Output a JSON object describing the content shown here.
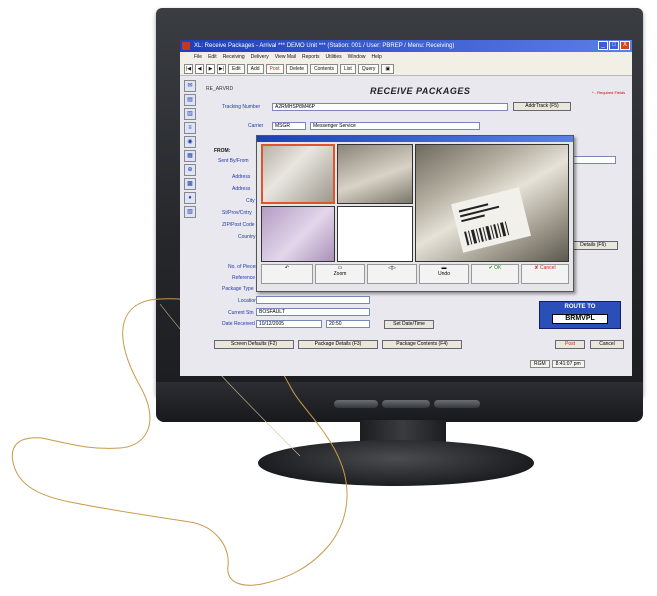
{
  "window": {
    "title": "XL: Receive Packages - Arrival *** DEMO Unit *** (Station: 001 / User: PBREP / Menu: Receiving)",
    "controls": [
      "_",
      "□",
      "X"
    ]
  },
  "menu": [
    "File",
    "Edit",
    "Receiving",
    "Delivery",
    "View Mail",
    "Reports",
    "Utilities",
    "Window",
    "Help"
  ],
  "toolbar": {
    "nav": [
      "|◀",
      "◀",
      "▶",
      "▶|"
    ],
    "buttons": [
      "Edit",
      "Add",
      "Post",
      "Delete",
      "Contents",
      "List",
      "Query"
    ]
  },
  "form": {
    "code": "RE_ARVRD",
    "heading": "RECEIVE PACKAGES",
    "required_note": "* - Required Fields",
    "tracking_label": "Tracking Number",
    "tracking_value": "A2RMHSP8M46P",
    "add_track_button": "AddrTrack (F5)",
    "carrier_label": "Carrier",
    "carrier_code": "MSGR",
    "carrier_name": "Messenger Service",
    "from_label": "FROM:",
    "from_labels": [
      "Sent By/From",
      "Address",
      "Address",
      "City",
      "St/Prov/Cntry",
      "ZIP/Post Code",
      "Country"
    ],
    "recipient_details_button": "Details (F6)",
    "misc_labels": [
      "No. of Pieces",
      "Reference",
      "Package Type",
      "Location",
      "Current Stn",
      "Date Received"
    ],
    "current_stn_value": "BOSFAULT",
    "date_value": "10/12/2005",
    "time_value": "20:50",
    "set_date_button": "Set Date/Time",
    "bottom_buttons": [
      "Screen Defaults (F2)",
      "Package Details (F3)",
      "Package Contents (F4)"
    ],
    "post_button": "Post",
    "cancel_button": "Cancel"
  },
  "route": {
    "label": "ROUTE TO",
    "value": "BRMVPL"
  },
  "status": {
    "user": "RGM",
    "time": "8:41:07 pm"
  },
  "modal": {
    "tools": [
      "Undo",
      "Zoom",
      "Stamp",
      "OK",
      "Cancel"
    ]
  }
}
